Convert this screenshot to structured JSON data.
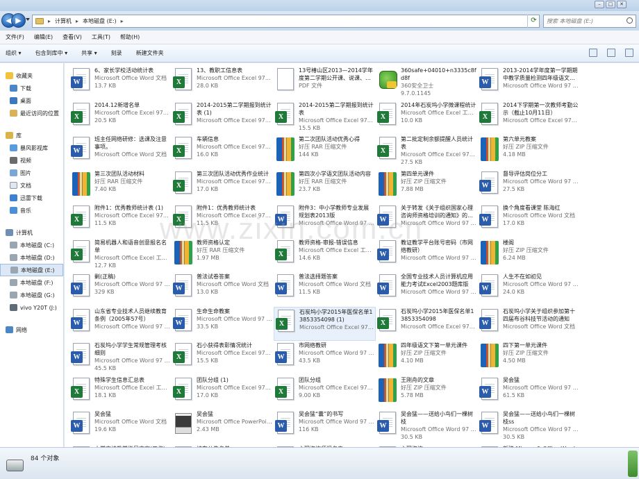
{
  "window": {
    "min": "–",
    "max": "□",
    "close": "✕"
  },
  "address": {
    "crumbs": [
      "计算机",
      "本地磁盘 (E:)"
    ],
    "search_placeholder": "搜索 本地磁盘 (E:)"
  },
  "menu": [
    "文件(F)",
    "编辑(E)",
    "查看(V)",
    "工具(T)",
    "帮助(H)"
  ],
  "toolbar": [
    "组织 ▾",
    "包含到库中 ▾",
    "共享 ▾",
    "刻录",
    "新建文件夹"
  ],
  "sidebar": {
    "favorites": {
      "label": "收藏夹",
      "items": [
        "下载",
        "桌面",
        "最近访问的位置"
      ]
    },
    "libraries": {
      "label": "库",
      "items": [
        "暴风影视库",
        "视频",
        "图片",
        "文档",
        "迅雷下载",
        "音乐"
      ]
    },
    "computer": {
      "label": "计算机",
      "items": [
        "本地磁盘 (C:)",
        "本地磁盘 (D:)",
        "本地磁盘 (E:)",
        "本地磁盘 (F:)",
        "本地磁盘 (G:)",
        "vivo Y20T (J:)"
      ]
    },
    "network": {
      "label": "网络"
    }
  },
  "files": [
    {
      "name": "6、家长学校活动统计表",
      "type": "Microsoft Office Word 文档",
      "size": "13.7 KB",
      "icon": "word"
    },
    {
      "name": "13、教职工信息表",
      "type": "Microsoft Office Excel 97-2003...",
      "size": "28.0 KB",
      "icon": "excel"
    },
    {
      "name": "13号椿山区2013—2014学年度第二学期公开课、说课、观摩交流...",
      "type": "PDF 文件",
      "size": "",
      "icon": "pdf"
    },
    {
      "name": "360safe+04010+n3335c8fd8f",
      "type": "360安全卫士",
      "size": "9.7.0.1145",
      "icon": "exe"
    },
    {
      "name": "2013-2014学年度第一学期期中教学质量检测四年级语文试卷",
      "type": "Microsoft Office Word 97 - 20...",
      "size": "",
      "icon": "word"
    },
    {
      "name": "2014.12新增名单",
      "type": "Microsoft Office Excel 97-2003...",
      "size": "20.5 KB",
      "icon": "excel"
    },
    {
      "name": "2014-2015第二学期报到统计表 (1)",
      "type": "Microsoft Office Excel 97-2003...",
      "size": "",
      "icon": "excel"
    },
    {
      "name": "2014-2015第二学期报到统计表",
      "type": "Microsoft Office Excel 97-2003...",
      "size": "15.5 KB",
      "icon": "excel"
    },
    {
      "name": "2014年石炭坞小学微课程统计",
      "type": "Microsoft Office Excel 工作表",
      "size": "10.0 KB",
      "icon": "excel"
    },
    {
      "name": "2014下学期第一次教师考勤公示（截止10月11日）",
      "type": "Microsoft Office Excel 97-2003...",
      "size": "",
      "icon": "excel"
    },
    {
      "name": "班主任网络研修：选课及注意事项。",
      "type": "Microsoft Office Word 文档",
      "size": "",
      "icon": "word"
    },
    {
      "name": "车辆信息",
      "type": "Microsoft Office Excel 97-2003...",
      "size": "16.0 KB",
      "icon": "excel"
    },
    {
      "name": "第二次团队活动优秀心得",
      "type": "好压 RAR 压缩文件",
      "size": "144 KB",
      "icon": "rar"
    },
    {
      "name": "第二批定制余额提醒人员统计表",
      "type": "Microsoft Office Excel 97-2003...",
      "size": "27.5 KB",
      "icon": "excel"
    },
    {
      "name": "第六单元教案",
      "type": "好压 ZIP 压缩文件",
      "size": "4.18 MB",
      "icon": "rar"
    },
    {
      "name": "第三次团队活动材料",
      "type": "好压 RAR 压缩文件",
      "size": "7.40 KB",
      "icon": "rar"
    },
    {
      "name": "第三次团队活动优秀作业统计",
      "type": "Microsoft Office Excel 97-2003...",
      "size": "17.0 KB",
      "icon": "excel"
    },
    {
      "name": "第四次小学语文团队活动内容",
      "type": "好压 RAR 压缩文件",
      "size": "23.7 KB",
      "icon": "rar"
    },
    {
      "name": "第四单元课件",
      "type": "好压 ZIP 压缩文件",
      "size": "7.88 MB",
      "icon": "rar"
    },
    {
      "name": "督导评估岗位分工",
      "type": "Microsoft Office Word 97 - 20...",
      "size": "27.5 KB",
      "icon": "word"
    },
    {
      "name": "附件1：优秀教师统计表 (1)",
      "type": "Microsoft Office Excel 97-2003...",
      "size": "11.5 KB",
      "icon": "excel"
    },
    {
      "name": "附件1：优秀教师统计表",
      "type": "Microsoft Office Excel 97-2003...",
      "size": "11.5 KB",
      "icon": "excel"
    },
    {
      "name": "附件3：中小学教师专业发展规划表2013版",
      "type": "Microsoft Office Word 97 - 20...",
      "size": "",
      "icon": "word"
    },
    {
      "name": "关于转发《关于组织国家心理咨询师资格培训的通知》的通知",
      "type": "Microsoft Office Word 97 - 20...",
      "size": "",
      "icon": "word"
    },
    {
      "name": "换个角度看课堂 陈海红",
      "type": "Microsoft Office Word 文档",
      "size": "17.0 KB",
      "icon": "word"
    },
    {
      "name": "简易机器人和语音创意报名名单",
      "type": "Microsoft Office Excel 工作表",
      "size": "12.7 KB",
      "icon": "excel"
    },
    {
      "name": "教师资格认定",
      "type": "好压 RAR 压缩文件",
      "size": "1.97 MB",
      "icon": "rar"
    },
    {
      "name": "教师资格-审报-错误信息",
      "type": "Microsoft Office Excel 工作表",
      "size": "14.6 KB",
      "icon": "excel"
    },
    {
      "name": "教证教学平台账号密码（市网络教研）",
      "type": "Microsoft Office Word 97 - 20...",
      "size": "",
      "icon": "word"
    },
    {
      "name": "楼阁",
      "type": "好压 ZIP 压缩文件",
      "size": "6.24 MB",
      "icon": "rar"
    },
    {
      "name": "剿(正稿)",
      "type": "Microsoft Office Word 97 - 20...",
      "size": "329 KB",
      "icon": "word"
    },
    {
      "name": "普法试卷答案",
      "type": "Microsoft Office Word 文档",
      "size": "13.0 KB",
      "icon": "word"
    },
    {
      "name": "普法选择题答案",
      "type": "Microsoft Office Word 文档",
      "size": "11.5 KB",
      "icon": "word"
    },
    {
      "name": "全国专业技术人员计算机应用能力考试Excel2003题库版",
      "type": "Microsoft Office Word 97 - 20...",
      "size": "",
      "icon": "word"
    },
    {
      "name": "人生不在如初见",
      "type": "Microsoft Office Word 97 - 20...",
      "size": "24.0 KB",
      "icon": "word"
    },
    {
      "name": "山东省专业技术人员继续教育条例（2005年57号）",
      "type": "Microsoft Office Word 97 - 20...",
      "size": "",
      "icon": "word"
    },
    {
      "name": "生命生命教案",
      "type": "Microsoft Office Word 97 - 20...",
      "size": "33.5 KB",
      "icon": "word"
    },
    {
      "name": "石炭坞小学2015年医保名单13853354098 (1)",
      "type": "Microsoft Office Excel 97-2003...",
      "size": "",
      "icon": "excel",
      "selected": true
    },
    {
      "name": "石炭坞小学2015年医保名单13853354098",
      "type": "Microsoft Office Excel 97-2003...",
      "size": "",
      "icon": "excel"
    },
    {
      "name": "石炭坞小学关于组织参加第十四届布谷科技节活动的通知",
      "type": "Microsoft Office Word 文档",
      "size": "",
      "icon": "word"
    },
    {
      "name": "石炭坞小学学生常规管理考核细则",
      "type": "Microsoft Office Word 97 - 20...",
      "size": "45.5 KB",
      "icon": "word"
    },
    {
      "name": "石小获得表彰情况统计",
      "type": "Microsoft Office Excel 97-2003...",
      "size": "15.5 KB",
      "icon": "excel"
    },
    {
      "name": "市网络教研",
      "type": "Microsoft Office Word 97 - 20...",
      "size": "43.5 KB",
      "icon": "word"
    },
    {
      "name": "四年级语文下第一单元课件",
      "type": "好压 ZIP 压缩文件",
      "size": "4.10 MB",
      "icon": "rar"
    },
    {
      "name": "四下第一单元课件",
      "type": "好压 ZIP 压缩文件",
      "size": "4.50 MB",
      "icon": "rar"
    },
    {
      "name": "特殊学生信息汇总表",
      "type": "Microsoft Office Excel 工作表",
      "size": "18.1 KB",
      "icon": "excel"
    },
    {
      "name": "团队分组 (1)",
      "type": "Microsoft Office Excel 97-2003...",
      "size": "17.0 KB",
      "icon": "excel"
    },
    {
      "name": "团队分组",
      "type": "Microsoft Office Excel 97-2003...",
      "size": "9.00 KB",
      "icon": "excel"
    },
    {
      "name": "王刚舟的文章",
      "type": "好压 ZIP 压缩文件",
      "size": "5.78 MB",
      "icon": "rar"
    },
    {
      "name": "吴会猛",
      "type": "Microsoft Office Word 97 - 20...",
      "size": "61.5 KB",
      "icon": "word"
    },
    {
      "name": "吴会猛",
      "type": "Microsoft Office Word 文档",
      "size": "19.6 KB",
      "icon": "word"
    },
    {
      "name": "吴会猛",
      "type": "Microsoft Office PowerPoint 9...",
      "size": "2.43 MB",
      "icon": "photo"
    },
    {
      "name": "吴会猛“囊”的书写",
      "type": "Microsoft Office Word 97 - 20...",
      "size": "116 KB",
      "icon": "word"
    },
    {
      "name": "吴会猛——送给小鸟们一棵树枝",
      "type": "Microsoft Office Word 97 - 20...",
      "size": "30.5 KB",
      "icon": "word"
    },
    {
      "name": "吴会猛——送给小鸟们一棵树枝ss",
      "type": "Microsoft Office Word 97 - 20...",
      "size": "30.5 KB",
      "icon": "word"
    },
    {
      "name": "小学古诗教学指导方案(工作)",
      "type": "",
      "size": "",
      "icon": "word"
    },
    {
      "name": "校车公告名单",
      "type": "",
      "size": "",
      "icon": "excel"
    },
    {
      "name": "心理咨询师报名表",
      "type": "",
      "size": "",
      "icon": "word"
    },
    {
      "name": "心理咨询",
      "type": "",
      "size": "",
      "icon": "word"
    },
    {
      "name": "新建 Microsoft Office Word 文档",
      "type": "",
      "size": "",
      "icon": "word"
    }
  ],
  "status": {
    "count": "84 个对象"
  },
  "watermark": "www.zixin.com.cn"
}
